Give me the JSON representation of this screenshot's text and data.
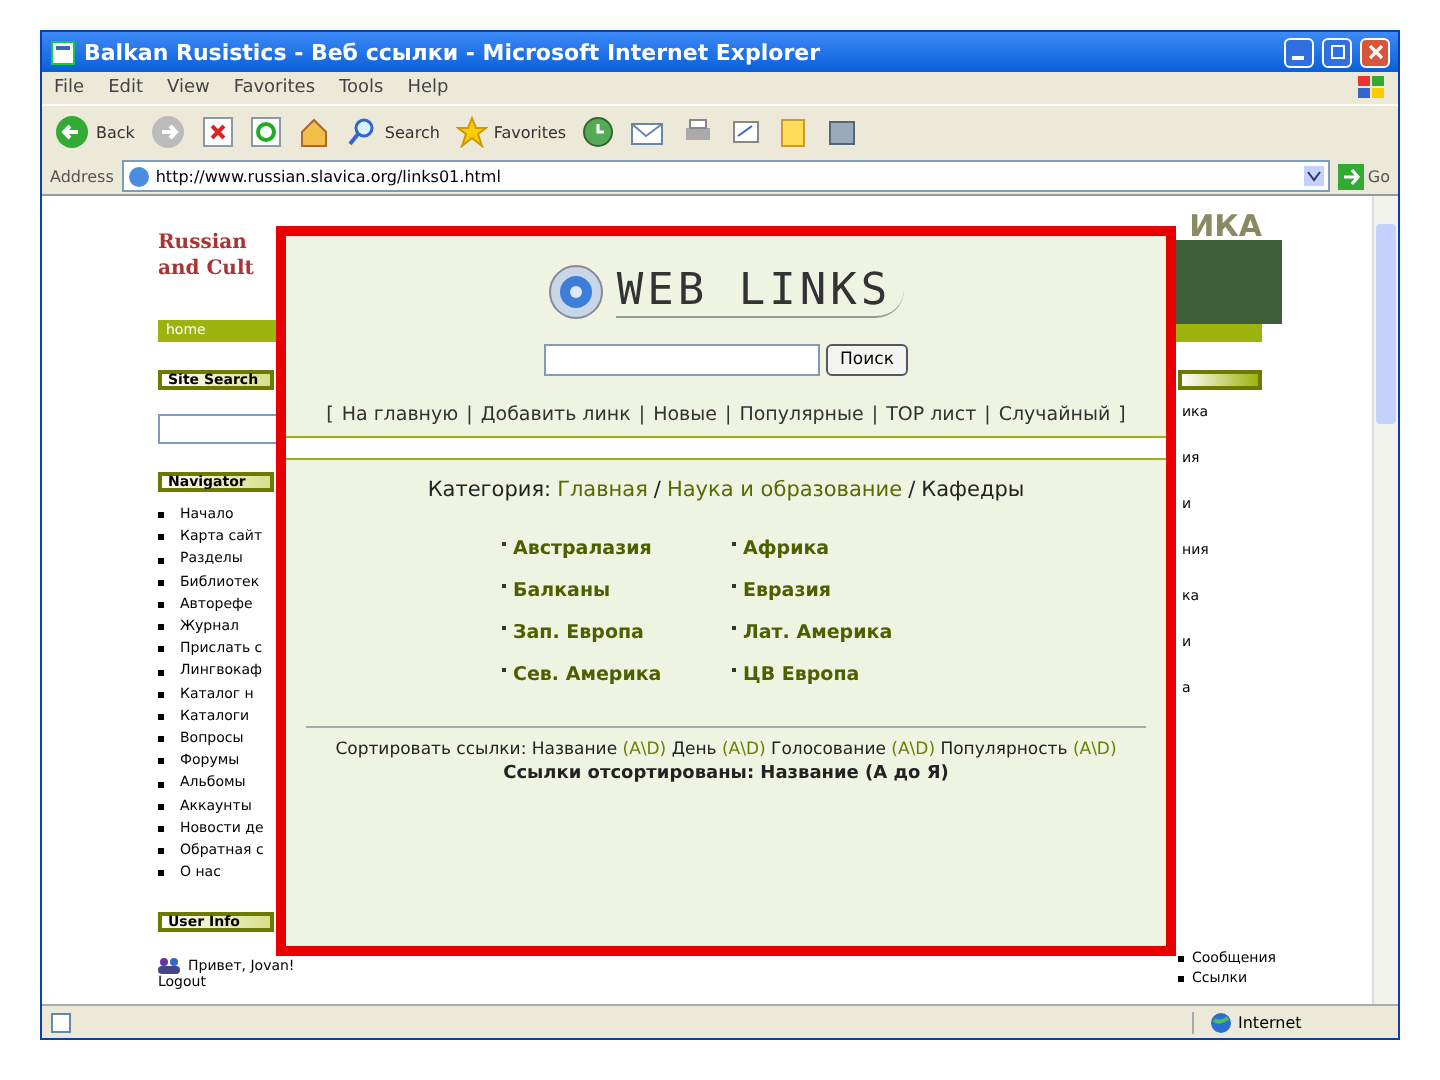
{
  "window": {
    "title": "Balkan Rusistics - Веб ссылки - Microsoft Internet Explorer"
  },
  "menu": [
    "File",
    "Edit",
    "View",
    "Favorites",
    "Tools",
    "Help"
  ],
  "toolbar": {
    "back": "Back",
    "search": "Search",
    "favorites": "Favorites"
  },
  "address": {
    "label": "Address",
    "value": "http://www.russian.slavica.org/links01.html",
    "go": "Go"
  },
  "site": {
    "header_lines": [
      "Russian",
      "and Cult"
    ],
    "banner_right": "ИКА",
    "home": "home",
    "site_search": "Site Search",
    "navigator": "Navigator",
    "nav_items": [
      "Начало",
      "Карта сайт",
      "Разделы",
      "Библиотек",
      "Авторефе",
      "Журнал",
      "Прислать с",
      "Лингвокаф",
      "Каталог н",
      "Каталоги",
      "Вопросы",
      "Форумы",
      "Альбомы",
      "Аккаунты",
      "Новости де",
      "Обратная с",
      "О нас"
    ],
    "user_info": "User Info",
    "greeting": "Привет, Jovan!",
    "logout": "Logout",
    "right_fragments": [
      "ика",
      "ия",
      "и",
      "ния",
      "ка",
      "и",
      "а"
    ],
    "right_bottom": [
      "Сообщения",
      "Ссылки"
    ]
  },
  "overlay": {
    "logo": "WEB LINKS",
    "search_button": "Поиск",
    "open_bracket": "[",
    "close_bracket": "]",
    "separator": "|",
    "links": [
      "На главную",
      "Добавить линк",
      "Новые",
      "Популярные",
      "TOP лист",
      "Случайный"
    ],
    "category_label": "Категория:",
    "crumb_separator": "/",
    "crumbs": [
      {
        "text": "Главная",
        "link": true
      },
      {
        "text": "Наука и образование",
        "link": true
      },
      {
        "text": "Кафедры",
        "link": false
      }
    ],
    "categories": [
      "Австралазия",
      "Африка",
      "Балканы",
      "Евразия",
      "Зап. Европа",
      "Лат. Америка",
      "Сев. Америка",
      "ЦВ Европа"
    ],
    "sort_label": "Сортировать ссылки:",
    "sort_items": [
      {
        "name": "Название",
        "order": "(A\\D)"
      },
      {
        "name": "День",
        "order": "(A\\D)"
      },
      {
        "name": "Голосование",
        "order": "(A\\D)"
      },
      {
        "name": "Популярность",
        "order": "(A\\D)"
      }
    ],
    "sorted": "Ссылки отсортированы: Название (А до Я)"
  },
  "status": {
    "zone": "Internet"
  }
}
